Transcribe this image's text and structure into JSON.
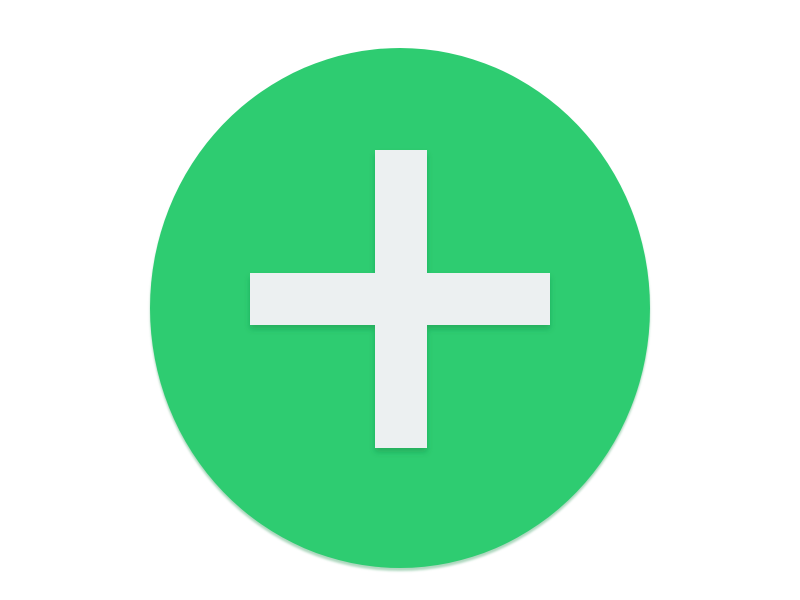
{
  "add_button": {
    "icon": "plus-icon",
    "background_color": "#2ecc71",
    "icon_color": "#ecf0f1"
  }
}
